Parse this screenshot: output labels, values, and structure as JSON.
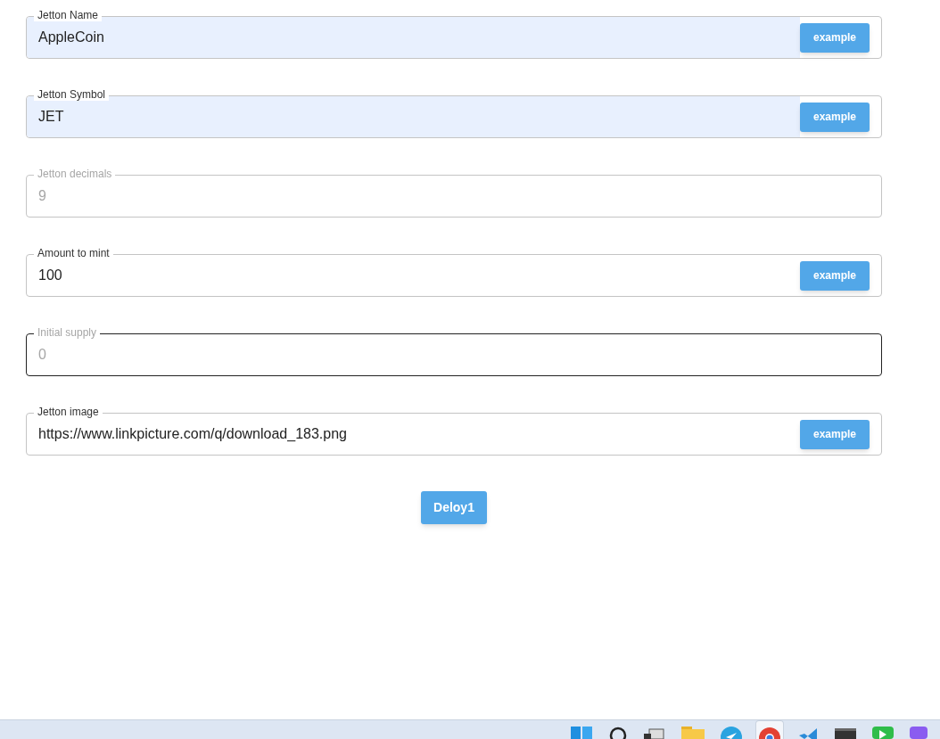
{
  "fields": [
    {
      "label": "Jetton Name",
      "value": "AppleCoin",
      "autofilled": true,
      "disabled": false,
      "focused": false,
      "button": "example"
    },
    {
      "label": "Jetton Symbol",
      "value": "JET",
      "autofilled": true,
      "disabled": false,
      "focused": false,
      "button": "example"
    },
    {
      "label": "Jetton decimals",
      "value": "9",
      "autofilled": false,
      "disabled": true,
      "focused": false
    },
    {
      "label": "Amount to mint",
      "value": "100",
      "autofilled": false,
      "disabled": false,
      "focused": false,
      "button": "example"
    },
    {
      "label": "Initial supply",
      "value": "0",
      "autofilled": false,
      "disabled": true,
      "focused": true
    },
    {
      "label": "Jetton image",
      "value": "https://www.linkpicture.com/q/download_183.png",
      "autofilled": false,
      "disabled": false,
      "focused": false,
      "button": "example"
    }
  ],
  "deploy_button": "Deloy1",
  "taskbar": {
    "apps": [
      {
        "kind": "start",
        "selected": false
      },
      {
        "kind": "search",
        "selected": false
      },
      {
        "kind": "taskview",
        "selected": false
      },
      {
        "kind": "folder",
        "selected": false
      },
      {
        "kind": "telegram",
        "selected": false
      },
      {
        "kind": "browser",
        "selected": true
      },
      {
        "kind": "editor",
        "selected": false
      },
      {
        "kind": "terminal",
        "selected": false
      },
      {
        "kind": "green",
        "selected": false
      },
      {
        "kind": "purple",
        "selected": false
      }
    ]
  }
}
